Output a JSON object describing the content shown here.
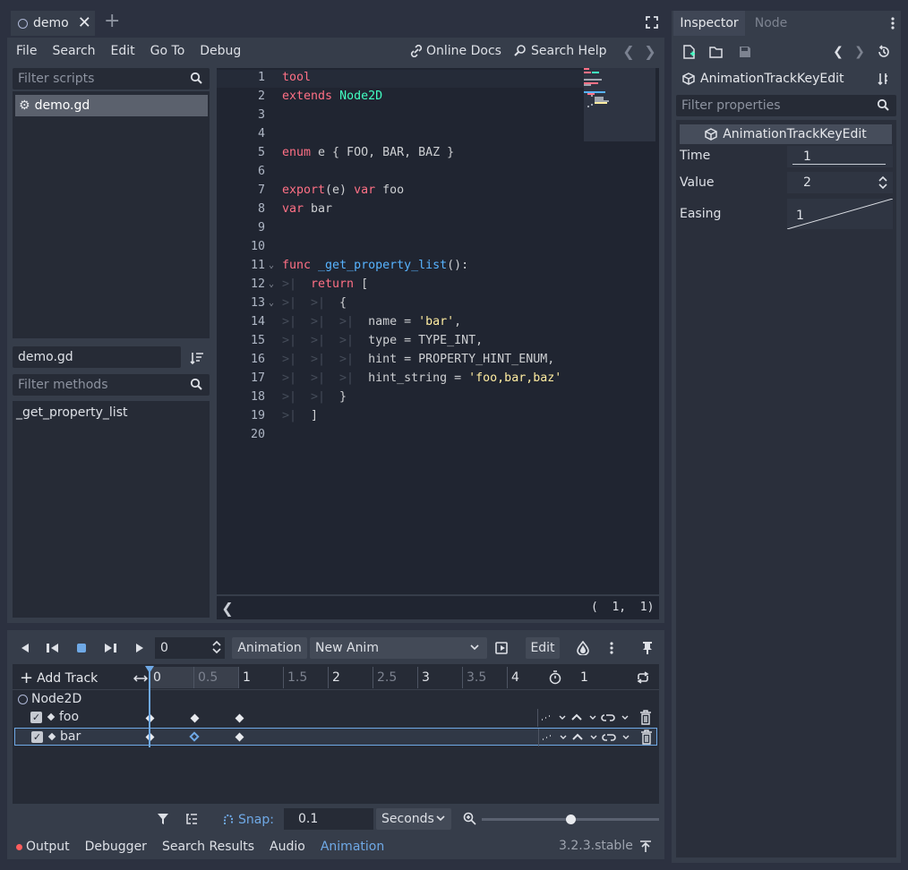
{
  "scene_tab": {
    "title": "demo"
  },
  "script_menu": [
    "File",
    "Search",
    "Edit",
    "Go To",
    "Debug"
  ],
  "help_links": {
    "online_docs": "Online Docs",
    "search_help": "Search Help"
  },
  "scripts_panel": {
    "filter_placeholder": "Filter scripts",
    "items": [
      "demo.gd"
    ],
    "current_script": "demo.gd",
    "methods_filter_placeholder": "Filter methods",
    "methods": [
      "_get_property_list"
    ]
  },
  "code": {
    "lines": [
      {
        "n": "1",
        "text": ""
      },
      {
        "n": "2",
        "text": ""
      },
      {
        "n": "3",
        "text": ""
      },
      {
        "n": "4",
        "text": ""
      },
      {
        "n": "5",
        "text": ""
      },
      {
        "n": "6",
        "text": ""
      },
      {
        "n": "7",
        "text": ""
      },
      {
        "n": "8",
        "text": ""
      },
      {
        "n": "9",
        "text": ""
      },
      {
        "n": "10",
        "text": ""
      },
      {
        "n": "11",
        "text": ""
      },
      {
        "n": "12",
        "text": ""
      },
      {
        "n": "13",
        "text": ""
      },
      {
        "n": "14",
        "text": ""
      },
      {
        "n": "15",
        "text": ""
      },
      {
        "n": "16",
        "text": ""
      },
      {
        "n": "17",
        "text": ""
      },
      {
        "n": "18",
        "text": ""
      },
      {
        "n": "19",
        "text": ""
      },
      {
        "n": "20",
        "text": ""
      }
    ],
    "cursor_position": "(  1,  1)"
  },
  "animation": {
    "time_value": "0",
    "animation_button": "Animation",
    "current_animation": "New Anim",
    "edit_button": "Edit",
    "add_track": "Add Track",
    "ruler_ticks": [
      "0",
      "0.5",
      "1",
      "1.5",
      "2",
      "2.5",
      "3",
      "3.5",
      "4"
    ],
    "length": "1",
    "node": "Node2D",
    "tracks": [
      {
        "name": "foo",
        "enabled": true,
        "keys": [
          0,
          0.5,
          1
        ],
        "selected": false
      },
      {
        "name": "bar",
        "enabled": true,
        "keys": [
          0,
          0.5,
          1
        ],
        "selected": true,
        "selected_key": 1
      }
    ],
    "snap_label": "Snap:",
    "snap_value": "0.1",
    "snap_mode": "Seconds",
    "zoom_level": 0.5
  },
  "bottom_tabs": [
    "Output",
    "Debugger",
    "Search Results",
    "Audio",
    "Animation"
  ],
  "active_bottom_tab": "Animation",
  "version": "3.2.3.stable",
  "inspector": {
    "tabs": [
      "Inspector",
      "Node"
    ],
    "object_name": "AnimationTrackKeyEdit",
    "filter_placeholder": "Filter properties",
    "section": "AnimationTrackKeyEdit",
    "properties": [
      {
        "label": "Time",
        "value": "1"
      },
      {
        "label": "Value",
        "value": "2"
      },
      {
        "label": "Easing",
        "value": "1"
      }
    ]
  },
  "colors": {
    "accent": "#6fa9e6",
    "keyword": "#ff7085",
    "type": "#42ffc2",
    "function": "#57b3ff",
    "string": "#ffeda1"
  }
}
